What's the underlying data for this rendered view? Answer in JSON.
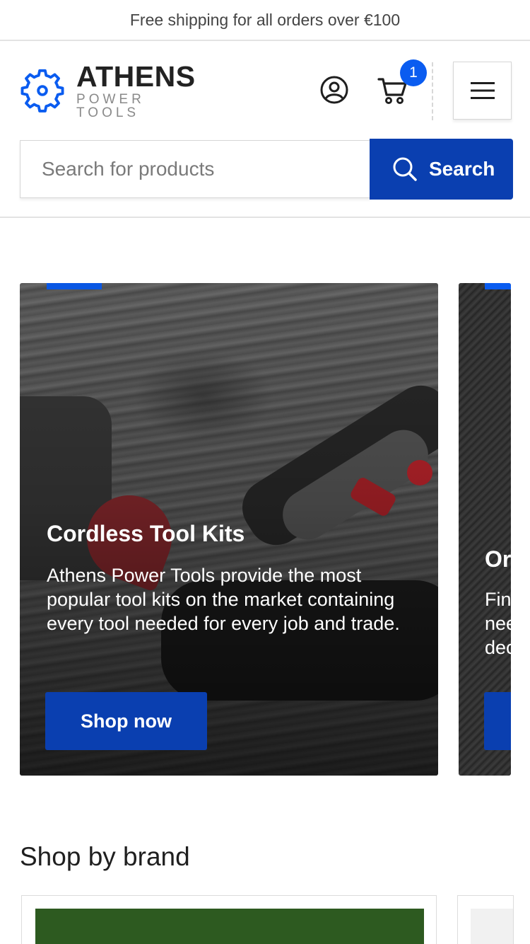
{
  "announcement": "Free shipping for all orders over €100",
  "brand": {
    "name": "ATHENS",
    "tagline": "POWER TOOLS",
    "accent_color": "#0a5cf0"
  },
  "header": {
    "cart_count": "1",
    "account_icon": "user-circle-icon",
    "cart_icon": "cart-icon",
    "menu_icon": "hamburger-menu-icon"
  },
  "search": {
    "placeholder": "Search for products",
    "button_label": "Search",
    "button_color": "#0a3fb0"
  },
  "carousel": {
    "slides": [
      {
        "title": "Cordless Tool Kits",
        "text": "Athens Power Tools provide the most popular tool kits on the market containing every tool needed for every job and trade.",
        "cta": "Shop now"
      },
      {
        "title": "Or",
        "text": "Fin\nnee\ndec"
      }
    ]
  },
  "brands_section": {
    "title": "Shop by brand"
  }
}
